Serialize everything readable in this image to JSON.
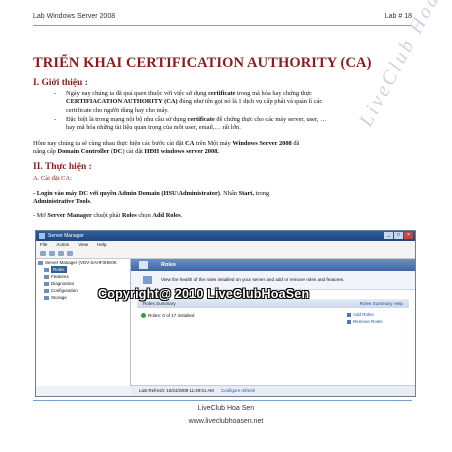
{
  "header": {
    "left": "Lab Windows Server 2008",
    "right": "Lab # 18"
  },
  "title": "TRIỂN KHAI CERTIFICATION AUTHORITY (CA)",
  "section1": {
    "heading": "I. Giới thiệu :",
    "bullet1": {
      "a": "Ngày nay chúng ta đã quá quen thuộc với việc sử dụng ",
      "b": "certificate",
      "c": " trong mã hóa hay chứng thực",
      "line2_bold": "CERTIFIACATION AUTHORITY (CA)",
      "line2_rest": " đúng như tên gọi nó là 1 dịch vụ cấp phát và quản lí các",
      "line3": "certificate cho người dùng hay cho máy."
    },
    "bullet2": {
      "a": "Đặc biệt là trong mạng nội bộ nhu cầu sử dụng ",
      "b": "certificate",
      "c": " để chứng thực cho các máy server, user, …",
      "line2": "hay mã hóa những tài liệu quan trọng của mỗi user, email,… rất lớn."
    },
    "para": {
      "a": "Hôm nay chúng ta sẽ cùng nhau thực hiện các bước cài đặt ",
      "b": "CA",
      "c": " trên Một máy ",
      "d": "Windows Server 2008",
      "e": " đã",
      "line2_a": "nâng cấp ",
      "line2_b": "Domain Controller",
      "line2_c": " (",
      "line2_d": "DC",
      "line2_e": ") cài đặt ",
      "line2_f": "HĐH windows server 2008."
    }
  },
  "section2": {
    "heading": "II. Thực hiện :",
    "sub": "A. Cài đặt CA:",
    "step1": {
      "a": "- Login vào máy DC với quyền Admin Domain (HSU\\Administrator)",
      "b": ". Nhấn ",
      "c": "Start,",
      "d": " trong",
      "line2": "Administrative Tools",
      "line2_end": "."
    },
    "step2": {
      "a": "- Mở ",
      "b": "Server Manager",
      "c": " chuột phải ",
      "d": "Roles",
      "e": " chọn ",
      "f": "Add Roles",
      "g": "."
    }
  },
  "watermark": "LiveClub Hoa Sen",
  "screenshot": {
    "window_title": "Server Manager",
    "menu": [
      "File",
      "Action",
      "View",
      "Help"
    ],
    "tree": [
      "Server Manager (VDV-SAHF3HE0K",
      "Roles",
      "Features",
      "Diagnostics",
      "Configuration",
      "Storage"
    ],
    "band_title": "Roles",
    "subtitle": "View the health of the roles installed on your server and add or remove roles and features.",
    "summary_bar": "Roles Summary",
    "summary_help": "Roles Summary Help",
    "roles_line": "Roles: 0 of 17 installed",
    "links": [
      "Add Roles",
      "Remove Roles"
    ],
    "status": "Last Refresh: 10/24/2009 11:49:51 AM",
    "status_link": "Configure refresh",
    "copyright": "Copyright@ 2010 LiveClubHoaSen"
  },
  "footer": {
    "line1": "LiveClub Hoa Sen",
    "line2": "www.liveclubhoasen.net"
  }
}
